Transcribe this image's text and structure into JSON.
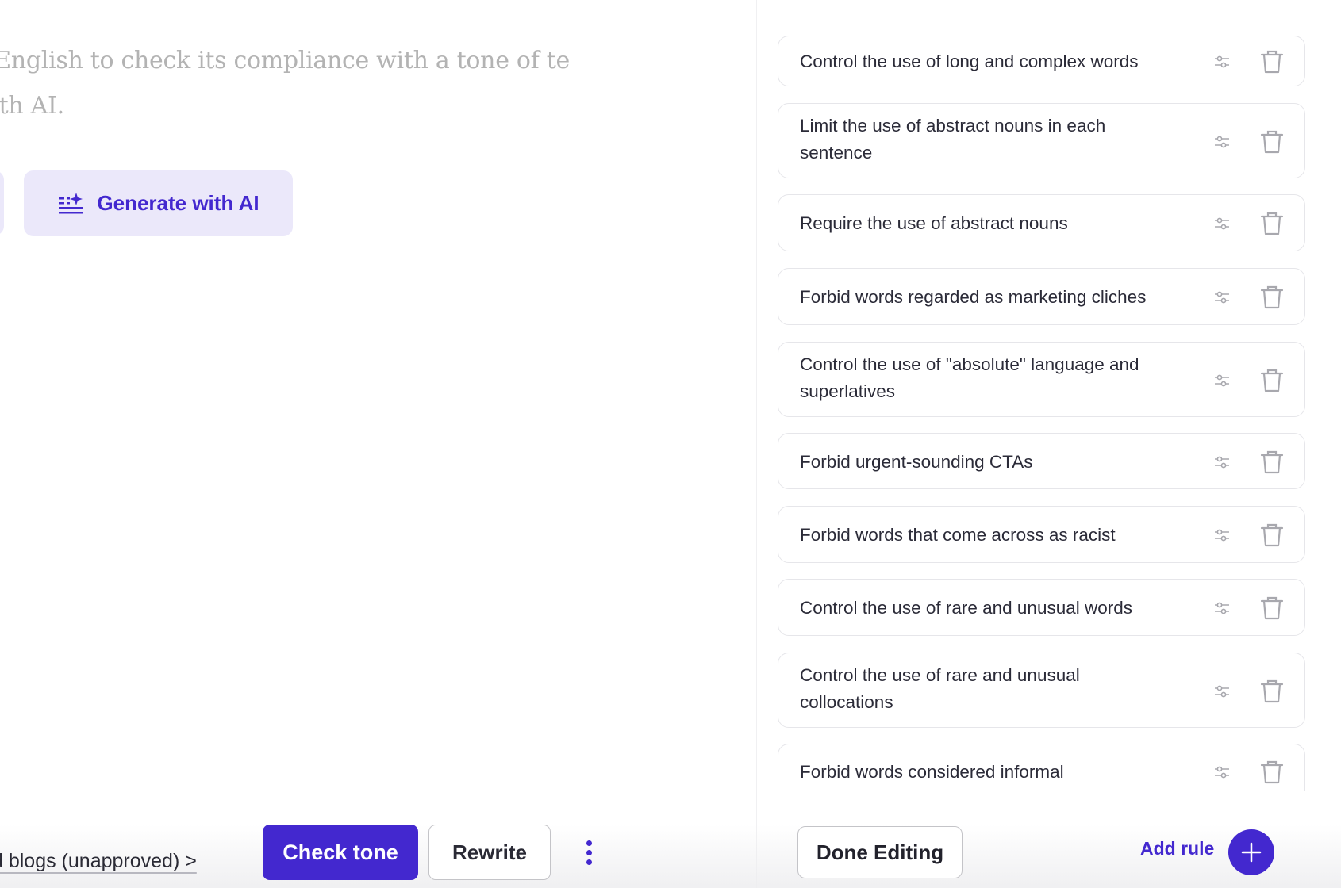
{
  "editor": {
    "intro_text": "n English to check its compliance with a tone of te with AI.",
    "generate_button": "Generate with AI",
    "breadcrumb": "d blogs (unapproved) >",
    "check_tone_button": "Check tone",
    "rewrite_button": "Rewrite"
  },
  "rules_panel": {
    "rules": [
      {
        "label": "Control the use of long and complex words"
      },
      {
        "label": "Limit the use of abstract nouns in each sentence"
      },
      {
        "label": "Require the use of abstract nouns"
      },
      {
        "label": "Forbid words regarded as marketing cliches"
      },
      {
        "label": "Control the use of \"absolute\" language and superlatives"
      },
      {
        "label": "Forbid urgent-sounding CTAs"
      },
      {
        "label": "Forbid words that come across as racist"
      },
      {
        "label": "Control the use of rare and unusual words"
      },
      {
        "label": "Control the use of rare and unusual collocations"
      },
      {
        "label": "Forbid words considered informal"
      }
    ],
    "done_button": "Done Editing",
    "add_rule_label": "Add rule"
  },
  "colors": {
    "accent": "#4328cf",
    "accent_light": "#ebe8fa",
    "icon_gray": "#a8a8ae"
  }
}
